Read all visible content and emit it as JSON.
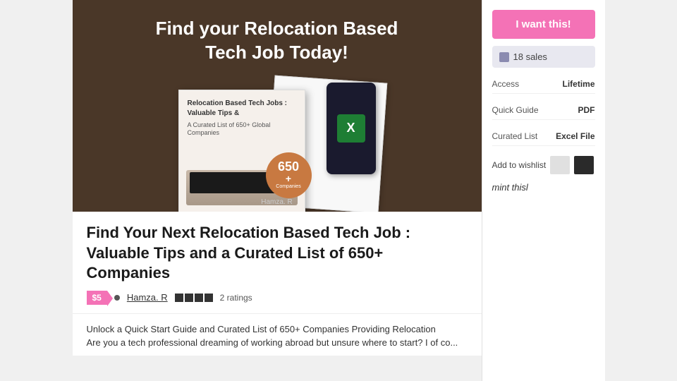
{
  "hero": {
    "title_line1": "Find your Relocation Based",
    "title_line2": "Tech Job Today!",
    "author_credit": "Hamza. R",
    "badge": {
      "number": "650+",
      "text": "Companies"
    }
  },
  "book": {
    "title": "Relocation Based Tech Jobs : Valuable Tips &",
    "subtitle": "A Curated List of 650+ Global Companies"
  },
  "product": {
    "title": "Find Your Next Relocation Based Tech Job : Valuable Tips and a Curated List of 650+ Companies",
    "price": "$5",
    "author": "Hamza. R",
    "ratings_count": "2 ratings",
    "description_line1": "Unlock a Quick Start Guide and Curated List of 650+ Companies Providing Relocation",
    "description_line2": "Are you a tech professional dreaming of working abroad but unsure where to start? I of co..."
  },
  "sidebar": {
    "want_button_label": "I want this!",
    "sales_count": "18 sales",
    "access_label": "Access",
    "access_value": "Lifetime",
    "quick_guide_label": "Quick Guide",
    "quick_guide_value": "PDF",
    "curated_list_label": "Curated List",
    "curated_list_value": "Excel File",
    "wishlist_label": "Add to wishlist",
    "mint_text": "mint thisl"
  },
  "icons": {
    "excel": "X",
    "star": "★"
  }
}
